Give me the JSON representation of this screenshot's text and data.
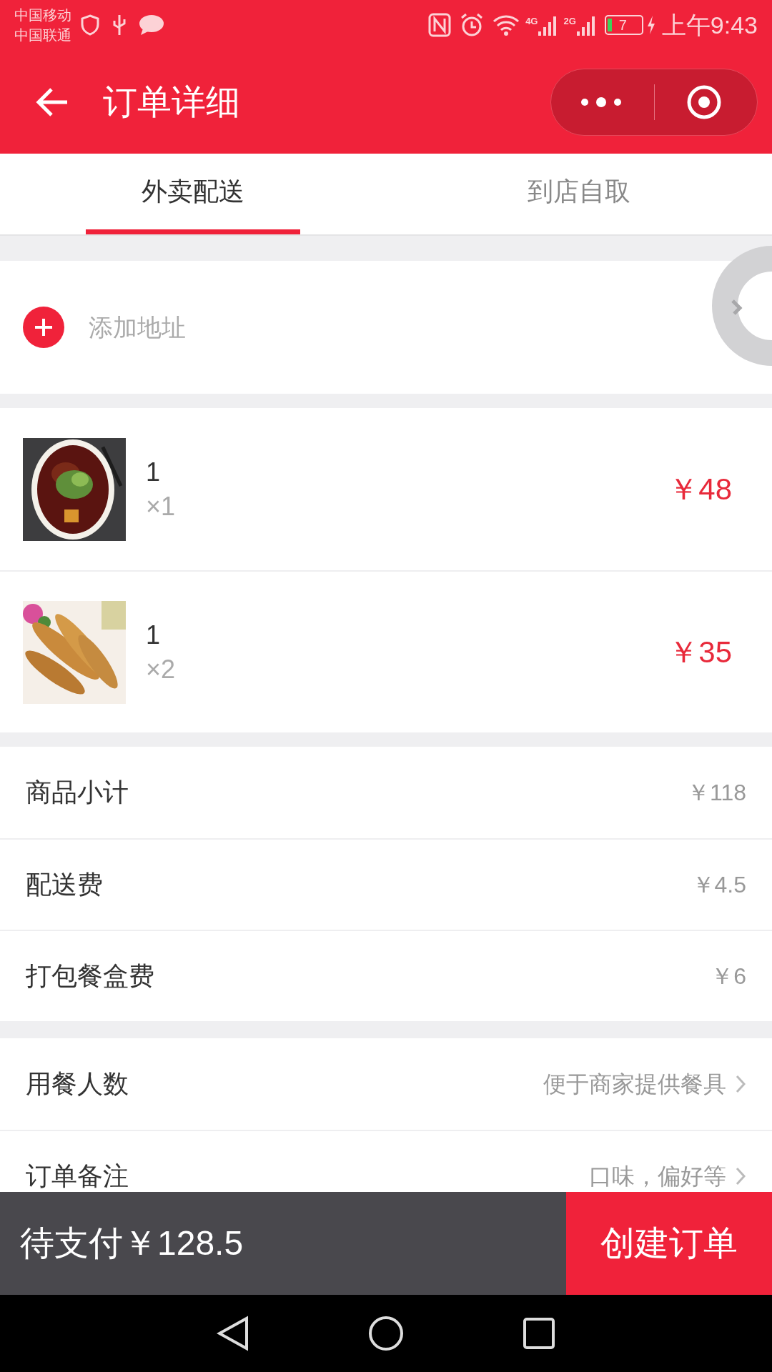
{
  "status_bar": {
    "carriers": [
      "中国移动",
      "中国联通"
    ],
    "network_labels": [
      "4G",
      "2G"
    ],
    "battery": "7",
    "time": "上午9:43"
  },
  "header": {
    "title": "订单详细"
  },
  "tabs": [
    {
      "label": "外卖配送",
      "selected": true
    },
    {
      "label": "到店自取",
      "selected": false
    }
  ],
  "address": {
    "placeholder": "添加地址"
  },
  "items": [
    {
      "name": "1",
      "quantity": "×1",
      "price": "￥48",
      "kind": "soup"
    },
    {
      "name": "1",
      "quantity": "×2",
      "price": "￥35",
      "kind": "fish"
    }
  ],
  "fees": [
    {
      "label": "商品小计",
      "value": "￥118"
    },
    {
      "label": "配送费",
      "value": "￥4.5"
    },
    {
      "label": "打包餐盒费",
      "value": "￥6"
    }
  ],
  "options": [
    {
      "label": "用餐人数",
      "hint": "便于商家提供餐具"
    },
    {
      "label": "订单备注",
      "hint": "口味，偏好等"
    }
  ],
  "footer": {
    "total": "待支付￥128.5",
    "submit": "创建订单"
  }
}
